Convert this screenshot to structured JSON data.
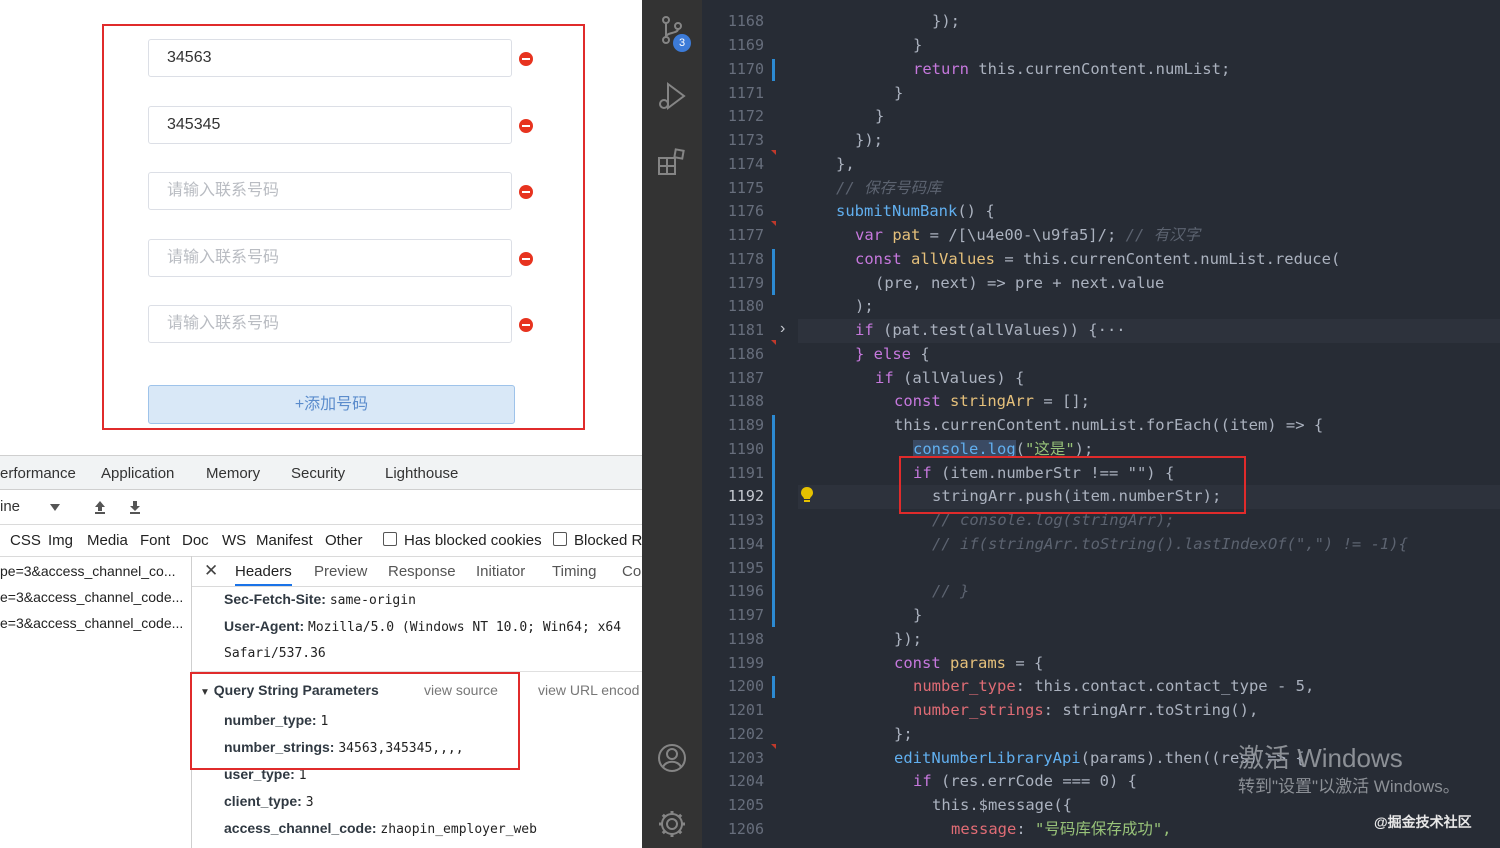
{
  "form": {
    "inputs": [
      {
        "value": "34563",
        "placeholder": "请输入联系号码"
      },
      {
        "value": "345345",
        "placeholder": "请输入联系号码"
      },
      {
        "value": "",
        "placeholder": "请输入联系号码"
      },
      {
        "value": "",
        "placeholder": "请输入联系号码"
      },
      {
        "value": "",
        "placeholder": "请输入联系号码"
      }
    ],
    "add_button_label": "+添加号码"
  },
  "devtools": {
    "tabs": [
      "erformance",
      "Application",
      "Memory",
      "Security",
      "Lighthouse"
    ],
    "toolbar": {
      "throttle": "ine"
    },
    "filters": [
      "CSS",
      "Img",
      "Media",
      "Font",
      "Doc",
      "WS",
      "Manifest",
      "Other"
    ],
    "has_blocked_cookies_label": "Has blocked cookies",
    "blocked_label": "Blocked Re",
    "requests": [
      "pe=3&access_channel_co...",
      "e=3&access_channel_code...",
      "e=3&access_channel_code..."
    ],
    "detail_tabs": [
      "Headers",
      "Preview",
      "Response",
      "Initiator",
      "Timing",
      "Co"
    ],
    "headers": {
      "sec_fetch_site_label": "Sec-Fetch-Site:",
      "sec_fetch_site_value": "same-origin",
      "user_agent_label": "User-Agent:",
      "user_agent_value": "Mozilla/5.0 (Windows NT 10.0; Win64; x64",
      "user_agent_cont": "Safari/537.36"
    },
    "query_string": {
      "title": "Query String Parameters",
      "view_source": "view source",
      "view_url": "view URL encod",
      "params": [
        {
          "key": "number_type:",
          "value": "1"
        },
        {
          "key": "number_strings:",
          "value": "34563,345345,,,,"
        },
        {
          "key": "user_type:",
          "value": "1"
        },
        {
          "key": "client_type:",
          "value": "3"
        },
        {
          "key": "access_channel_code:",
          "value": "zhaopin_employer_web"
        }
      ]
    }
  },
  "activity_bar": {
    "source_control_badge": "3"
  },
  "editor": {
    "line_numbers": [
      "1168",
      "1169",
      "1170",
      "1171",
      "1172",
      "1173",
      "1174",
      "1175",
      "1176",
      "1177",
      "1178",
      "1179",
      "1180",
      "1181",
      "1186",
      "1187",
      "1188",
      "1189",
      "1190",
      "1191",
      "1192",
      "1193",
      "1194",
      "1195",
      "1196",
      "1197",
      "1198",
      "1199",
      "1200",
      "1201",
      "1202",
      "1203",
      "1204",
      "1205",
      "1206"
    ],
    "current_line": "1192",
    "code": {
      "l1168_text": "});",
      "l1169_text": "}",
      "l1170_kw": "return",
      "l1170_text": " this.currenContent.numList;",
      "l1171_text": "}",
      "l1172_text": "}",
      "l1173_text": "});",
      "l1174_text": "},",
      "l1175_comment": "// 保存号码库",
      "l1176_fn": "submitNumBank",
      "l1176_text": "() {",
      "l1177_kw": "var",
      "l1177_var": " pat",
      "l1177_text": " = /[\\u4e00-\\u9fa5]/;",
      "l1177_comment": " // 有汉字",
      "l1178_kw": "const",
      "l1178_var": " allValues",
      "l1178_text": " = this.currenContent.numList.reduce(",
      "l1179_text": "(pre, next) => pre + next.value",
      "l1180_text": ");",
      "l1181_kw": "if",
      "l1181_text": " (pat.test(allValues)) {···",
      "l1186_kw": "} else",
      "l1186_text": " {",
      "l1187_kw": "if",
      "l1187_text": " (allValues) {",
      "l1188_kw": "const",
      "l1188_var": " stringArr",
      "l1188_text": " = [];",
      "l1189_text": "this.currenContent.numList.forEach((item) => {",
      "l1190_fn": "console.log",
      "l1190_str": "\"这是\"",
      "l1191_kw": "if",
      "l1191_text": " (item.numberStr !== \"\") {",
      "l1192_text": "stringArr.push(item.numberStr);",
      "l1193_comment": "// console.log(stringArr);",
      "l1194_comment": "// if(stringArr.toString().lastIndexOf(\",\") != -1){",
      "l1196_comment": "// }",
      "l1197_text": "}",
      "l1198_text": "});",
      "l1199_kw": "const",
      "l1199_var": " params",
      "l1199_text": " = {",
      "l1200_prop": "number_type",
      "l1200_text": ": this.contact.contact_type - 5,",
      "l1201_prop": "number_strings",
      "l1201_text": ": stringArr.toString(),",
      "l1202_text": "};",
      "l1203_fn": "editNumberLibraryApi",
      "l1203_text": "(params).then((res) => {",
      "l1204_kw": "if",
      "l1204_text": " (res.errCode === 0) {",
      "l1205_text": "this.$message({",
      "l1206_prop": "message",
      "l1206_str": "\"号码库保存成功\","
    }
  },
  "watermark": {
    "line1": "激活 Windows",
    "line2": "转到\"设置\"以激活 Windows。"
  },
  "juejin": "@掘金技术社区"
}
